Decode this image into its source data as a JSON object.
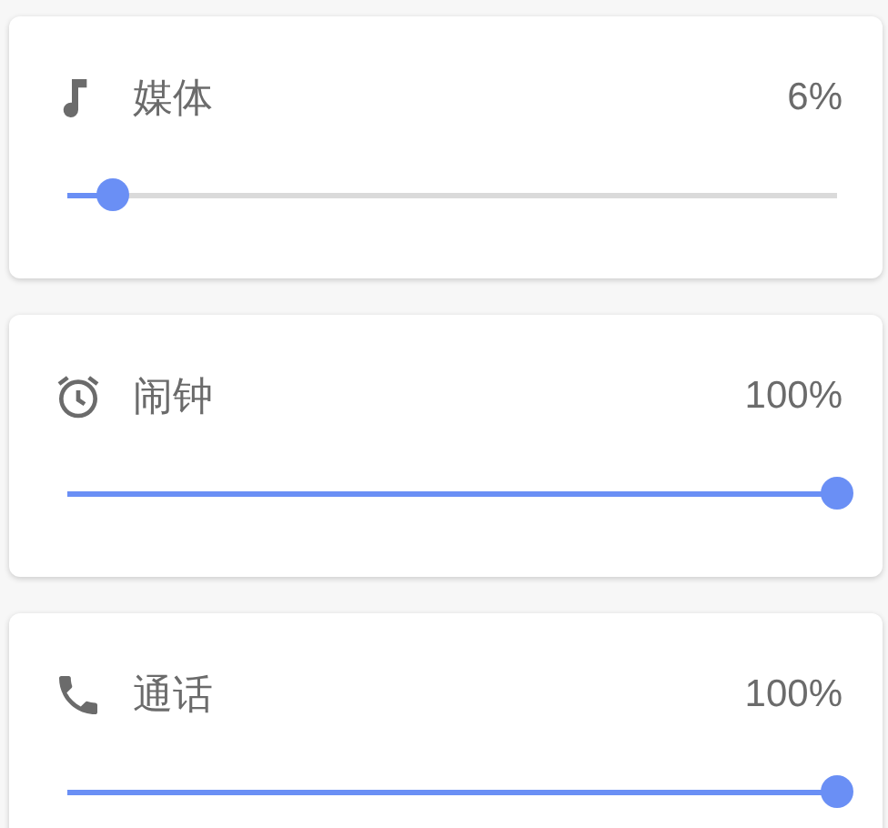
{
  "channels": [
    {
      "kind": "music",
      "name": "媒体",
      "reading": "6%",
      "level": 0.06
    },
    {
      "kind": "alarm",
      "name": "闹钟",
      "reading": "100%",
      "level": 1
    },
    {
      "kind": "phone",
      "name": "通话",
      "reading": "100%",
      "level": 1
    }
  ]
}
